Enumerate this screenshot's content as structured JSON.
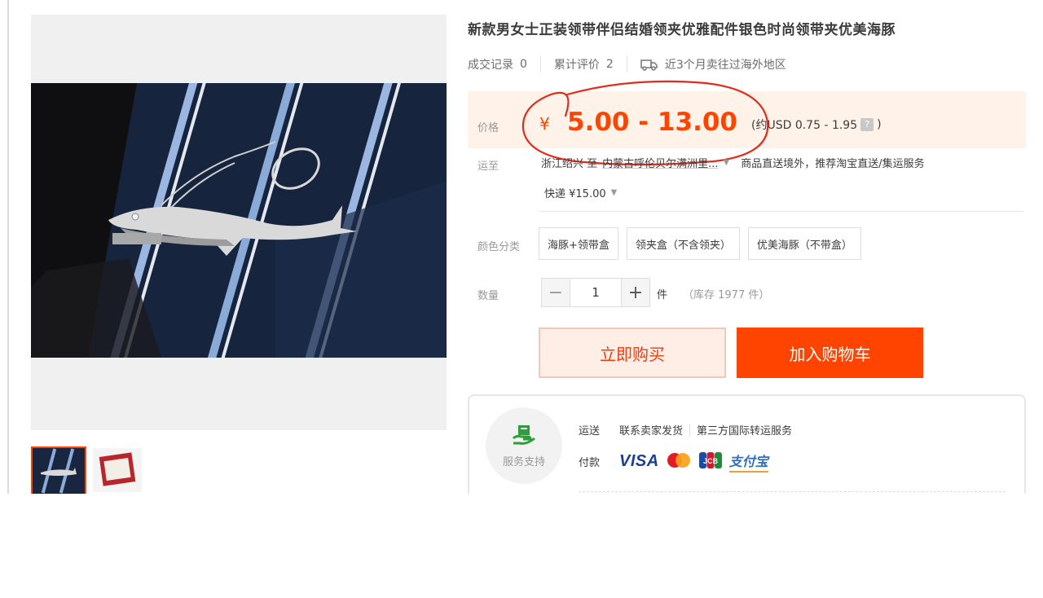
{
  "product": {
    "title": "新款男女士正装领带伴侣结婚领夹优雅配件银色时尚领带夹优美海豚"
  },
  "stats": {
    "deals_label": "成交记录",
    "deals_count": "0",
    "reviews_label": "累计评价",
    "reviews_count": "2",
    "shipping_note": "近3个月卖往过海外地区",
    "shipping_icon": "truck-icon"
  },
  "price": {
    "label": "价格",
    "currency": "¥",
    "range": "5.00 - 13.00",
    "usd": "(约USD 0.75 - 1.95",
    "usd_close": ")",
    "help_glyph": "?",
    "band_color": "#fff2e8",
    "accent": "#ff4400"
  },
  "shipping": {
    "label": "运至",
    "origin": "浙江绍兴 至",
    "destination": "内蒙古呼伦贝尔满洲里...",
    "service_note": "商品直送境外，推荐淘宝直送/集运服务",
    "method": "快递 ¥15.00"
  },
  "colors": {
    "label": "颜色分类",
    "options": [
      "海豚+领带盒",
      "领夹盒（不含领夹）",
      "优美海豚（不带盒）"
    ]
  },
  "quantity": {
    "label": "数量",
    "minus": "−",
    "value": "1",
    "plus": "+",
    "unit": "件",
    "stock": "（库存 1977 件）"
  },
  "actions": {
    "buy_now": "立即购买",
    "add_to_cart": "加入购物车"
  },
  "service": {
    "badge_label": "服务支持",
    "badge_icon": "service-icon",
    "shipping_key": "运送",
    "shipping_value": "联系卖家发货",
    "shipping_extra": "第三方国际转运服务",
    "payment_key": "付款",
    "payment_methods": [
      "VISA",
      "mastercard",
      "JCB",
      "支付宝"
    ]
  },
  "gallery": {
    "thumbnails": [
      "dolphin-tie-clip",
      "gift-box"
    ]
  }
}
